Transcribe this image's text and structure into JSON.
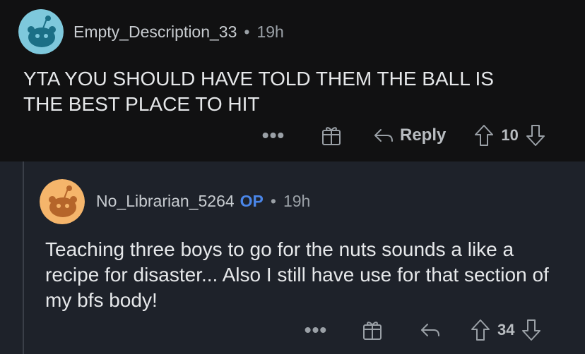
{
  "top_comment": {
    "username": "Empty_Description_33",
    "separator": "•",
    "time": "19h",
    "body": "YTA YOU SHOULD HAVE TOLD THEM THE BALL IS THE BEST PLACE TO HIT",
    "more_label": "•••",
    "award_icon": "gift-award-icon",
    "reply_label": "Reply",
    "vote_count": "10",
    "colors": {
      "background": "#111112",
      "avatar": "#7ec8dc"
    }
  },
  "reply_comment": {
    "username": "No_Librarian_5264",
    "op_label": "OP",
    "separator": "•",
    "time": "19h",
    "body": "Teaching three boys to go for the nuts sounds a like a recipe for disaster... Also I still have use for that section of my bfs body!",
    "more_label": "•••",
    "award_icon": "gift-award-icon",
    "vote_count": "34",
    "colors": {
      "background": "#1e222a",
      "avatar": "#f5b56b",
      "op": "#4a86e8"
    }
  }
}
